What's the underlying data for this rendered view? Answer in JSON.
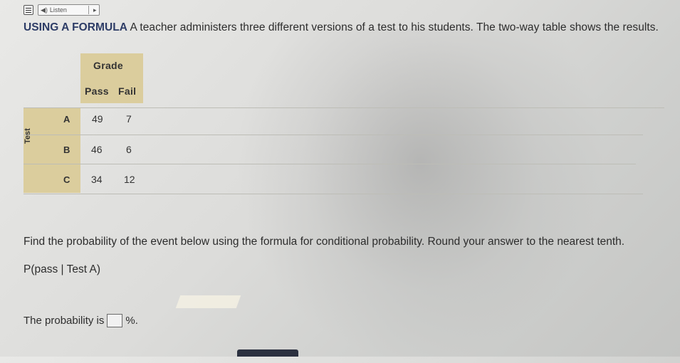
{
  "toolbar": {
    "listen_label": "Listen",
    "play_glyph": "▸",
    "speaker_glyph": "◀)"
  },
  "question": {
    "heading": "USING A FORMULA",
    "text": "A teacher administers three different versions of a test to his students. The two-way table shows the results."
  },
  "table": {
    "column_group": "Grade",
    "columns": [
      "Pass",
      "Fail"
    ],
    "row_group": "Test",
    "rows": [
      {
        "label": "A",
        "pass": "49",
        "fail": "7"
      },
      {
        "label": "B",
        "pass": "46",
        "fail": "6"
      },
      {
        "label": "C",
        "pass": "34",
        "fail": "12"
      }
    ]
  },
  "instructions": "Find the probability of the event below using the formula for conditional probability. Round your answer to the nearest tenth.",
  "event": "P(pass | Test A)",
  "answer": {
    "prefix": "The probability is",
    "value": "",
    "suffix": "%",
    "end": "."
  },
  "colors": {
    "table_fill": "#dbcd9d",
    "heading": "#2d3c66"
  }
}
